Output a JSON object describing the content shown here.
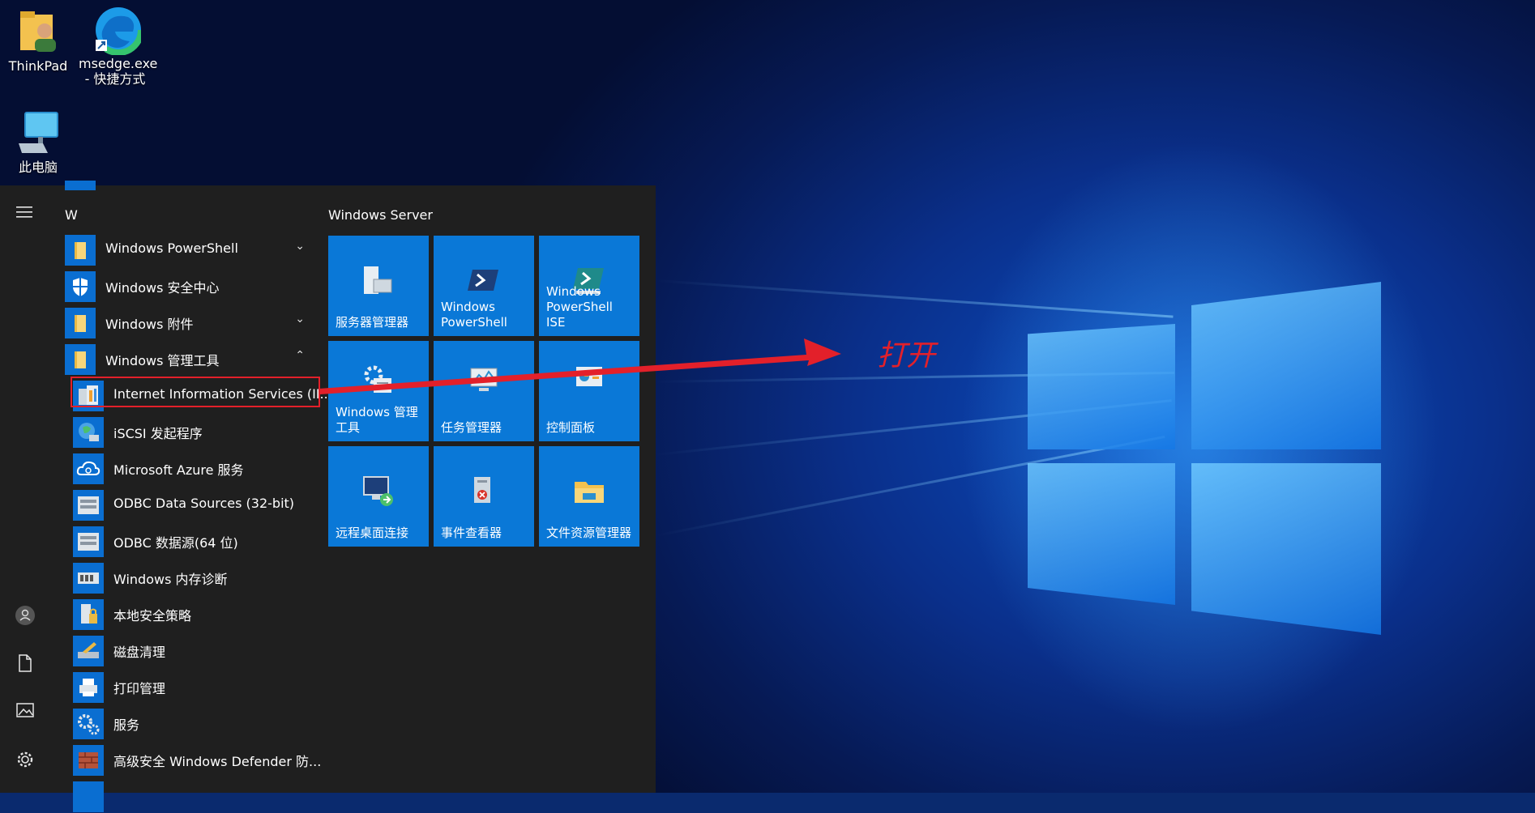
{
  "desktop": {
    "icons": [
      {
        "label_line1": "ThinkPad",
        "label_line2": "",
        "icon": "folder-user-icon"
      },
      {
        "label_line1": "msedge.exe",
        "label_line2": "- 快捷方式",
        "icon": "edge-icon"
      },
      {
        "label_line1": "此电脑",
        "label_line2": "",
        "icon": "computer-icon"
      }
    ]
  },
  "start_menu": {
    "letter": "W",
    "apps": [
      {
        "label": "Windows PowerShell",
        "chevron": "⌄",
        "icon": "folder-icon"
      },
      {
        "label": "Windows 安全中心",
        "chevron": "",
        "icon": "shield-icon"
      },
      {
        "label": "Windows 附件",
        "chevron": "⌄",
        "icon": "folder-icon"
      },
      {
        "label": "Windows 管理工具",
        "chevron": "⌃",
        "icon": "folder-icon"
      },
      {
        "label": "Internet Information Services (II...",
        "icon": "iis-icon"
      },
      {
        "label": "iSCSI 发起程序",
        "icon": "globe-icon"
      },
      {
        "label": "Microsoft Azure 服务",
        "icon": "cloud-icon"
      },
      {
        "label": "ODBC Data Sources (32-bit)",
        "icon": "database-icon"
      },
      {
        "label": "ODBC 数据源(64 位)",
        "icon": "database-icon"
      },
      {
        "label": "Windows 内存诊断",
        "icon": "memory-icon"
      },
      {
        "label": "本地安全策略",
        "icon": "policy-icon"
      },
      {
        "label": "磁盘清理",
        "icon": "disk-cleanup-icon"
      },
      {
        "label": "打印管理",
        "icon": "printer-icon"
      },
      {
        "label": "服务",
        "icon": "gear-icon"
      },
      {
        "label": "高级安全 Windows Defender 防...",
        "icon": "firewall-icon"
      }
    ],
    "tile_group_title": "Windows Server",
    "tiles": [
      {
        "label": "服务器管理器",
        "icon": "server-manager-icon"
      },
      {
        "label": "Windows PowerShell",
        "icon": "powershell-icon"
      },
      {
        "label": "Windows PowerShell ISE",
        "icon": "powershell-ise-icon"
      },
      {
        "label": "Windows 管理工具",
        "icon": "admin-tools-icon"
      },
      {
        "label": "任务管理器",
        "icon": "task-manager-icon"
      },
      {
        "label": "控制面板",
        "icon": "control-panel-icon"
      },
      {
        "label": "远程桌面连接",
        "icon": "remote-desktop-icon"
      },
      {
        "label": "事件查看器",
        "icon": "event-viewer-icon"
      },
      {
        "label": "文件资源管理器",
        "icon": "file-explorer-icon"
      }
    ]
  },
  "annotation": {
    "text": "打开",
    "color": "#e3202a"
  },
  "colors": {
    "tile_blue": "#0a78d7",
    "menu_bg": "#1f1f1f"
  }
}
